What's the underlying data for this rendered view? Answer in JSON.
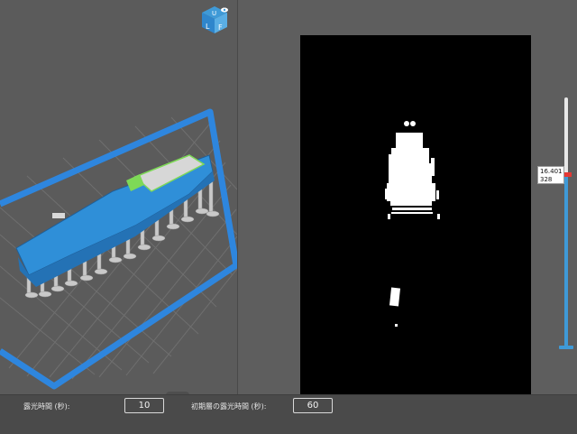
{
  "viewport": {
    "view_cube_faces": [
      "U",
      "F",
      "L"
    ],
    "colors": {
      "build_plate_frame": "#2e86de",
      "model": "#2f8fd8",
      "supports": "#c9c9c9",
      "grid": "#6e6e6e",
      "selection": "#7ed957"
    }
  },
  "slice_preview": {
    "background": "#000000",
    "pixel_color": "#ffffff"
  },
  "layer_slider": {
    "height_mm": "16.401",
    "layer_number": "328",
    "position_fraction": 0.31,
    "colors": {
      "active": "#3f9ad7",
      "handle": "#e53935"
    }
  },
  "bottom_panel": {
    "exposure_label": "露光時間 (秒):",
    "exposure_value": "10",
    "initial_exposure_label": "初期層の露光時間 (秒):",
    "initial_exposure_value": "60"
  },
  "collapse_toggle_icon": "triangle-down-icon"
}
